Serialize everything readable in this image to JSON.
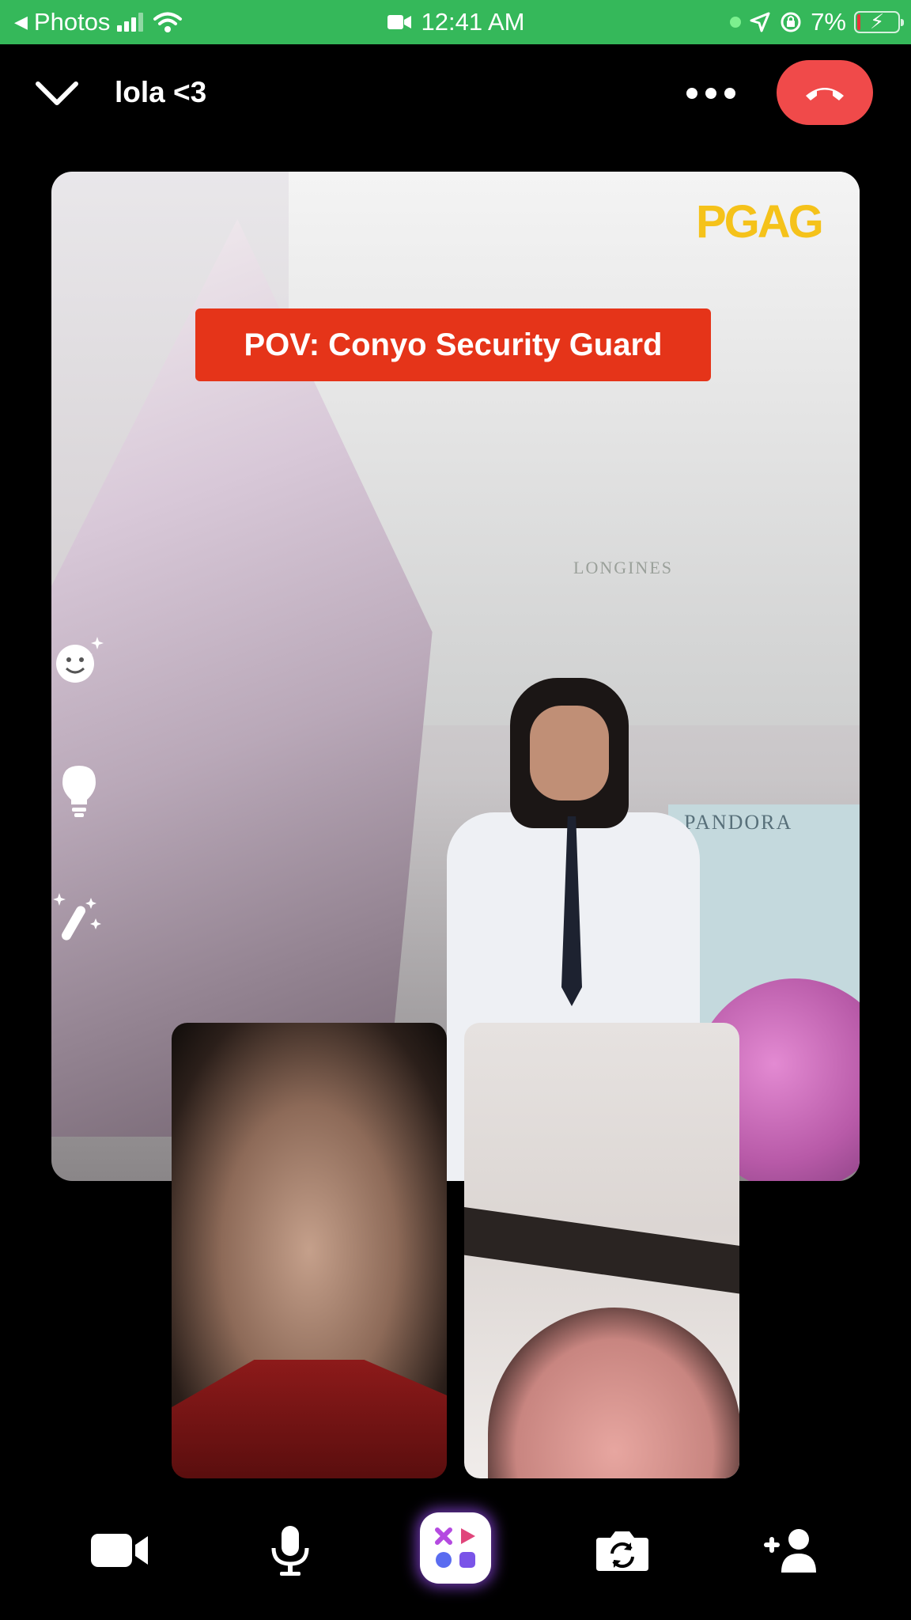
{
  "status_bar": {
    "back_label": "Photos",
    "time": "12:41 AM",
    "battery_percent": "7%",
    "battery_level": 0.07,
    "icons": [
      "back-arrow-icon",
      "signal-icon",
      "wifi-icon",
      "camera-recording-icon",
      "location-icon",
      "rotation-lock-icon",
      "battery-charging-icon"
    ]
  },
  "header": {
    "title": "lola <3",
    "collapse_icon": "chevron-down-icon",
    "more_icon": "more-icon",
    "end_call_icon": "end-call-icon",
    "end_call_color": "#f04a4a"
  },
  "main_video": {
    "caption": "POV: Conyo Security Guard",
    "watermark": "PGAG",
    "sign_top": "LONGINES",
    "sign_bottom": "PANDORA",
    "side_tools": [
      "face-effects-icon",
      "lightbulb-icon",
      "magic-wand-icon"
    ]
  },
  "participants": [
    {
      "role": "participant-video-1"
    },
    {
      "role": "participant-video-2"
    }
  ],
  "controls": {
    "items": [
      "video-camera-icon",
      "microphone-icon",
      "effects-icon",
      "flip-camera-icon",
      "add-person-icon"
    ]
  },
  "colors": {
    "status_bar": "#35b85a",
    "background": "#000000",
    "caption_bg": "#e53419",
    "watermark": "#f5c21a"
  }
}
